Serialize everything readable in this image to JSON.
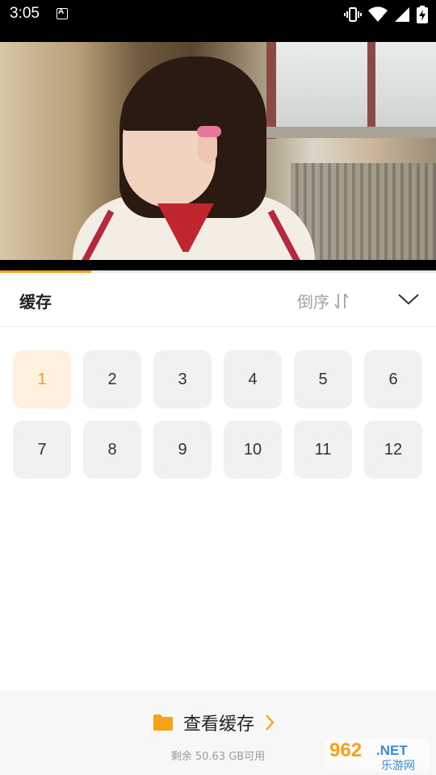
{
  "status_bar": {
    "time": "3:05",
    "notification_icon": "a-icon",
    "icons": [
      "vibrate-icon",
      "wifi-icon",
      "signal-icon",
      "battery-charging-icon"
    ]
  },
  "video": {
    "progress": 0.21,
    "accent_color": "#f5a216"
  },
  "panel": {
    "title": "缓存",
    "sort_label": "倒序",
    "sort_icon": "sort-arrows-icon",
    "collapse_icon": "chevron-down-icon"
  },
  "episodes": {
    "items": [
      "1",
      "2",
      "3",
      "4",
      "5",
      "6",
      "7",
      "8",
      "9",
      "10",
      "11",
      "12"
    ],
    "selected": "1"
  },
  "footer": {
    "view_cache_label": "查看缓存",
    "folder_icon": "folder-icon",
    "arrow_icon": "chevron-right-icon",
    "storage_text": "剩余 50.63 GB可用"
  },
  "watermark": {
    "text_top": "962",
    "text_net": ".NET",
    "text_bottom": "乐游网"
  }
}
